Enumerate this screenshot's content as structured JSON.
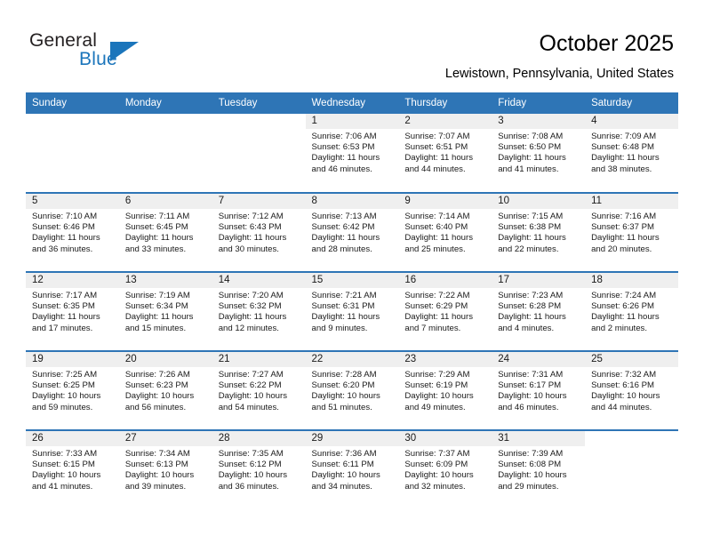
{
  "brand": {
    "name_part1": "General",
    "name_part2": "Blue",
    "accent_color": "#1b75bb",
    "triangle_icon": "triangle-icon"
  },
  "header": {
    "title": "October 2025",
    "location": "Lewistown, Pennsylvania, United States"
  },
  "calendar": {
    "header_color": "#2e75b6",
    "daynum_band_color": "#efefef",
    "weekday_headers": [
      "Sunday",
      "Monday",
      "Tuesday",
      "Wednesday",
      "Thursday",
      "Friday",
      "Saturday"
    ],
    "labels": {
      "sunrise": "Sunrise:",
      "sunset": "Sunset:",
      "daylight": "Daylight:"
    },
    "weeks": [
      [
        {
          "empty": true
        },
        {
          "empty": true
        },
        {
          "empty": true
        },
        {
          "day": "1",
          "sunrise": "Sunrise: 7:06 AM",
          "sunset": "Sunset: 6:53 PM",
          "daylight": "Daylight: 11 hours and 46 minutes."
        },
        {
          "day": "2",
          "sunrise": "Sunrise: 7:07 AM",
          "sunset": "Sunset: 6:51 PM",
          "daylight": "Daylight: 11 hours and 44 minutes."
        },
        {
          "day": "3",
          "sunrise": "Sunrise: 7:08 AM",
          "sunset": "Sunset: 6:50 PM",
          "daylight": "Daylight: 11 hours and 41 minutes."
        },
        {
          "day": "4",
          "sunrise": "Sunrise: 7:09 AM",
          "sunset": "Sunset: 6:48 PM",
          "daylight": "Daylight: 11 hours and 38 minutes."
        }
      ],
      [
        {
          "day": "5",
          "sunrise": "Sunrise: 7:10 AM",
          "sunset": "Sunset: 6:46 PM",
          "daylight": "Daylight: 11 hours and 36 minutes."
        },
        {
          "day": "6",
          "sunrise": "Sunrise: 7:11 AM",
          "sunset": "Sunset: 6:45 PM",
          "daylight": "Daylight: 11 hours and 33 minutes."
        },
        {
          "day": "7",
          "sunrise": "Sunrise: 7:12 AM",
          "sunset": "Sunset: 6:43 PM",
          "daylight": "Daylight: 11 hours and 30 minutes."
        },
        {
          "day": "8",
          "sunrise": "Sunrise: 7:13 AM",
          "sunset": "Sunset: 6:42 PM",
          "daylight": "Daylight: 11 hours and 28 minutes."
        },
        {
          "day": "9",
          "sunrise": "Sunrise: 7:14 AM",
          "sunset": "Sunset: 6:40 PM",
          "daylight": "Daylight: 11 hours and 25 minutes."
        },
        {
          "day": "10",
          "sunrise": "Sunrise: 7:15 AM",
          "sunset": "Sunset: 6:38 PM",
          "daylight": "Daylight: 11 hours and 22 minutes."
        },
        {
          "day": "11",
          "sunrise": "Sunrise: 7:16 AM",
          "sunset": "Sunset: 6:37 PM",
          "daylight": "Daylight: 11 hours and 20 minutes."
        }
      ],
      [
        {
          "day": "12",
          "sunrise": "Sunrise: 7:17 AM",
          "sunset": "Sunset: 6:35 PM",
          "daylight": "Daylight: 11 hours and 17 minutes."
        },
        {
          "day": "13",
          "sunrise": "Sunrise: 7:19 AM",
          "sunset": "Sunset: 6:34 PM",
          "daylight": "Daylight: 11 hours and 15 minutes."
        },
        {
          "day": "14",
          "sunrise": "Sunrise: 7:20 AM",
          "sunset": "Sunset: 6:32 PM",
          "daylight": "Daylight: 11 hours and 12 minutes."
        },
        {
          "day": "15",
          "sunrise": "Sunrise: 7:21 AM",
          "sunset": "Sunset: 6:31 PM",
          "daylight": "Daylight: 11 hours and 9 minutes."
        },
        {
          "day": "16",
          "sunrise": "Sunrise: 7:22 AM",
          "sunset": "Sunset: 6:29 PM",
          "daylight": "Daylight: 11 hours and 7 minutes."
        },
        {
          "day": "17",
          "sunrise": "Sunrise: 7:23 AM",
          "sunset": "Sunset: 6:28 PM",
          "daylight": "Daylight: 11 hours and 4 minutes."
        },
        {
          "day": "18",
          "sunrise": "Sunrise: 7:24 AM",
          "sunset": "Sunset: 6:26 PM",
          "daylight": "Daylight: 11 hours and 2 minutes."
        }
      ],
      [
        {
          "day": "19",
          "sunrise": "Sunrise: 7:25 AM",
          "sunset": "Sunset: 6:25 PM",
          "daylight": "Daylight: 10 hours and 59 minutes."
        },
        {
          "day": "20",
          "sunrise": "Sunrise: 7:26 AM",
          "sunset": "Sunset: 6:23 PM",
          "daylight": "Daylight: 10 hours and 56 minutes."
        },
        {
          "day": "21",
          "sunrise": "Sunrise: 7:27 AM",
          "sunset": "Sunset: 6:22 PM",
          "daylight": "Daylight: 10 hours and 54 minutes."
        },
        {
          "day": "22",
          "sunrise": "Sunrise: 7:28 AM",
          "sunset": "Sunset: 6:20 PM",
          "daylight": "Daylight: 10 hours and 51 minutes."
        },
        {
          "day": "23",
          "sunrise": "Sunrise: 7:29 AM",
          "sunset": "Sunset: 6:19 PM",
          "daylight": "Daylight: 10 hours and 49 minutes."
        },
        {
          "day": "24",
          "sunrise": "Sunrise: 7:31 AM",
          "sunset": "Sunset: 6:17 PM",
          "daylight": "Daylight: 10 hours and 46 minutes."
        },
        {
          "day": "25",
          "sunrise": "Sunrise: 7:32 AM",
          "sunset": "Sunset: 6:16 PM",
          "daylight": "Daylight: 10 hours and 44 minutes."
        }
      ],
      [
        {
          "day": "26",
          "sunrise": "Sunrise: 7:33 AM",
          "sunset": "Sunset: 6:15 PM",
          "daylight": "Daylight: 10 hours and 41 minutes."
        },
        {
          "day": "27",
          "sunrise": "Sunrise: 7:34 AM",
          "sunset": "Sunset: 6:13 PM",
          "daylight": "Daylight: 10 hours and 39 minutes."
        },
        {
          "day": "28",
          "sunrise": "Sunrise: 7:35 AM",
          "sunset": "Sunset: 6:12 PM",
          "daylight": "Daylight: 10 hours and 36 minutes."
        },
        {
          "day": "29",
          "sunrise": "Sunrise: 7:36 AM",
          "sunset": "Sunset: 6:11 PM",
          "daylight": "Daylight: 10 hours and 34 minutes."
        },
        {
          "day": "30",
          "sunrise": "Sunrise: 7:37 AM",
          "sunset": "Sunset: 6:09 PM",
          "daylight": "Daylight: 10 hours and 32 minutes."
        },
        {
          "day": "31",
          "sunrise": "Sunrise: 7:39 AM",
          "sunset": "Sunset: 6:08 PM",
          "daylight": "Daylight: 10 hours and 29 minutes."
        },
        {
          "empty": true
        }
      ]
    ]
  }
}
